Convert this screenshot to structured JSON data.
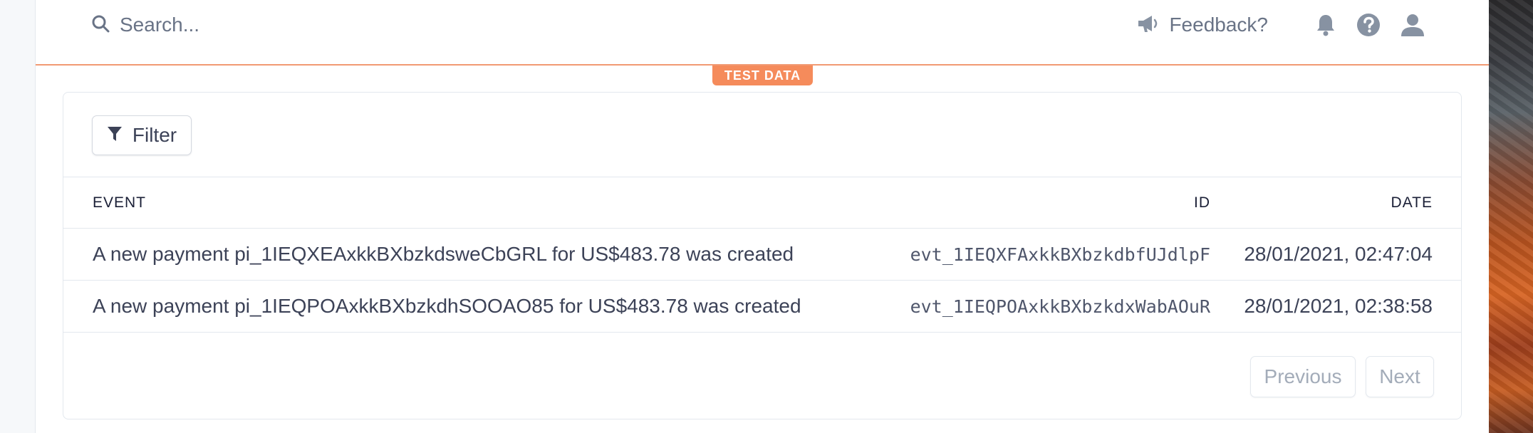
{
  "search": {
    "placeholder": "Search..."
  },
  "header": {
    "feedback_label": "Feedback?"
  },
  "badge": {
    "test_data": "TEST DATA"
  },
  "toolbar": {
    "filter_label": "Filter"
  },
  "table": {
    "columns": {
      "event": "EVENT",
      "id": "ID",
      "date": "DATE"
    },
    "rows": [
      {
        "event": "A new payment pi_1IEQXEAxkkBXbzkdsweCbGRL for US$483.78 was created",
        "id": "evt_1IEQXFAxkkBXbzkdbfUJdlpF",
        "date": "28/01/2021, 02:47:04"
      },
      {
        "event": "A new payment pi_1IEQPOAxkkBXbzkdhSOOAO85 for US$483.78 was created",
        "id": "evt_1IEQPOAxkkBXbzkdxWabAOuR",
        "date": "28/01/2021, 02:38:58"
      }
    ]
  },
  "pagination": {
    "previous_label": "Previous",
    "next_label": "Next"
  },
  "colors": {
    "accent": "#f58b5b",
    "text": "#3c4257",
    "muted": "#697386"
  },
  "icons": [
    "search-icon",
    "megaphone-icon",
    "bell-icon",
    "help-icon",
    "user-icon",
    "filter-icon"
  ]
}
